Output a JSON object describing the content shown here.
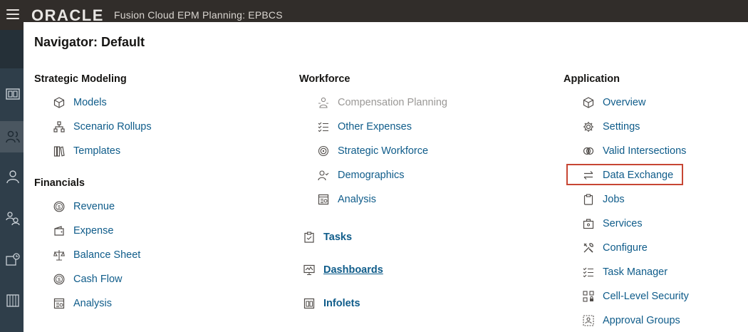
{
  "header": {
    "logo": "ORACLE",
    "app_title": "Fusion Cloud EPM Planning:  EPBCS"
  },
  "navigator": {
    "title": "Navigator: Default"
  },
  "strategic_modeling": {
    "heading": "Strategic Modeling",
    "items": [
      {
        "label": "Models",
        "icon": "cube-icon"
      },
      {
        "label": "Scenario Rollups",
        "icon": "hierarchy-icon"
      },
      {
        "label": "Templates",
        "icon": "books-icon"
      }
    ]
  },
  "financials": {
    "heading": "Financials",
    "items": [
      {
        "label": "Revenue",
        "icon": "dollar-circle-icon"
      },
      {
        "label": "Expense",
        "icon": "wallet-icon"
      },
      {
        "label": "Balance Sheet",
        "icon": "scale-icon"
      },
      {
        "label": "Cash Flow",
        "icon": "dollar-circle-icon"
      },
      {
        "label": "Analysis",
        "icon": "report-icon"
      }
    ]
  },
  "workforce": {
    "heading": "Workforce",
    "items": [
      {
        "label": "Compensation Planning",
        "icon": "people-money-icon",
        "disabled": true
      },
      {
        "label": "Other Expenses",
        "icon": "checklist-icon"
      },
      {
        "label": "Strategic Workforce",
        "icon": "target-person-icon"
      },
      {
        "label": "Demographics",
        "icon": "person-check-icon"
      },
      {
        "label": "Analysis",
        "icon": "report-icon"
      }
    ]
  },
  "links": {
    "tasks": "Tasks",
    "dashboards": "Dashboards",
    "infolets": "Infolets"
  },
  "application": {
    "heading": "Application",
    "items": [
      {
        "label": "Overview",
        "icon": "cube-icon"
      },
      {
        "label": "Settings",
        "icon": "gear-icon"
      },
      {
        "label": "Valid Intersections",
        "icon": "intersection-icon"
      },
      {
        "label": "Data Exchange",
        "icon": "exchange-arrows-icon"
      },
      {
        "label": "Jobs",
        "icon": "clipboard-icon"
      },
      {
        "label": "Services",
        "icon": "briefcase-icon"
      },
      {
        "label": "Configure",
        "icon": "tools-icon"
      },
      {
        "label": "Task Manager",
        "icon": "checklist-icon"
      },
      {
        "label": "Cell-Level Security",
        "icon": "grid-lock-icon"
      },
      {
        "label": "Approval Groups",
        "icon": "group-box-icon"
      }
    ]
  },
  "colors": {
    "link": "#0f5c8a",
    "highlight_border": "#c74634",
    "topbar": "#312d2a",
    "sidebar": "#2f3e4a"
  }
}
